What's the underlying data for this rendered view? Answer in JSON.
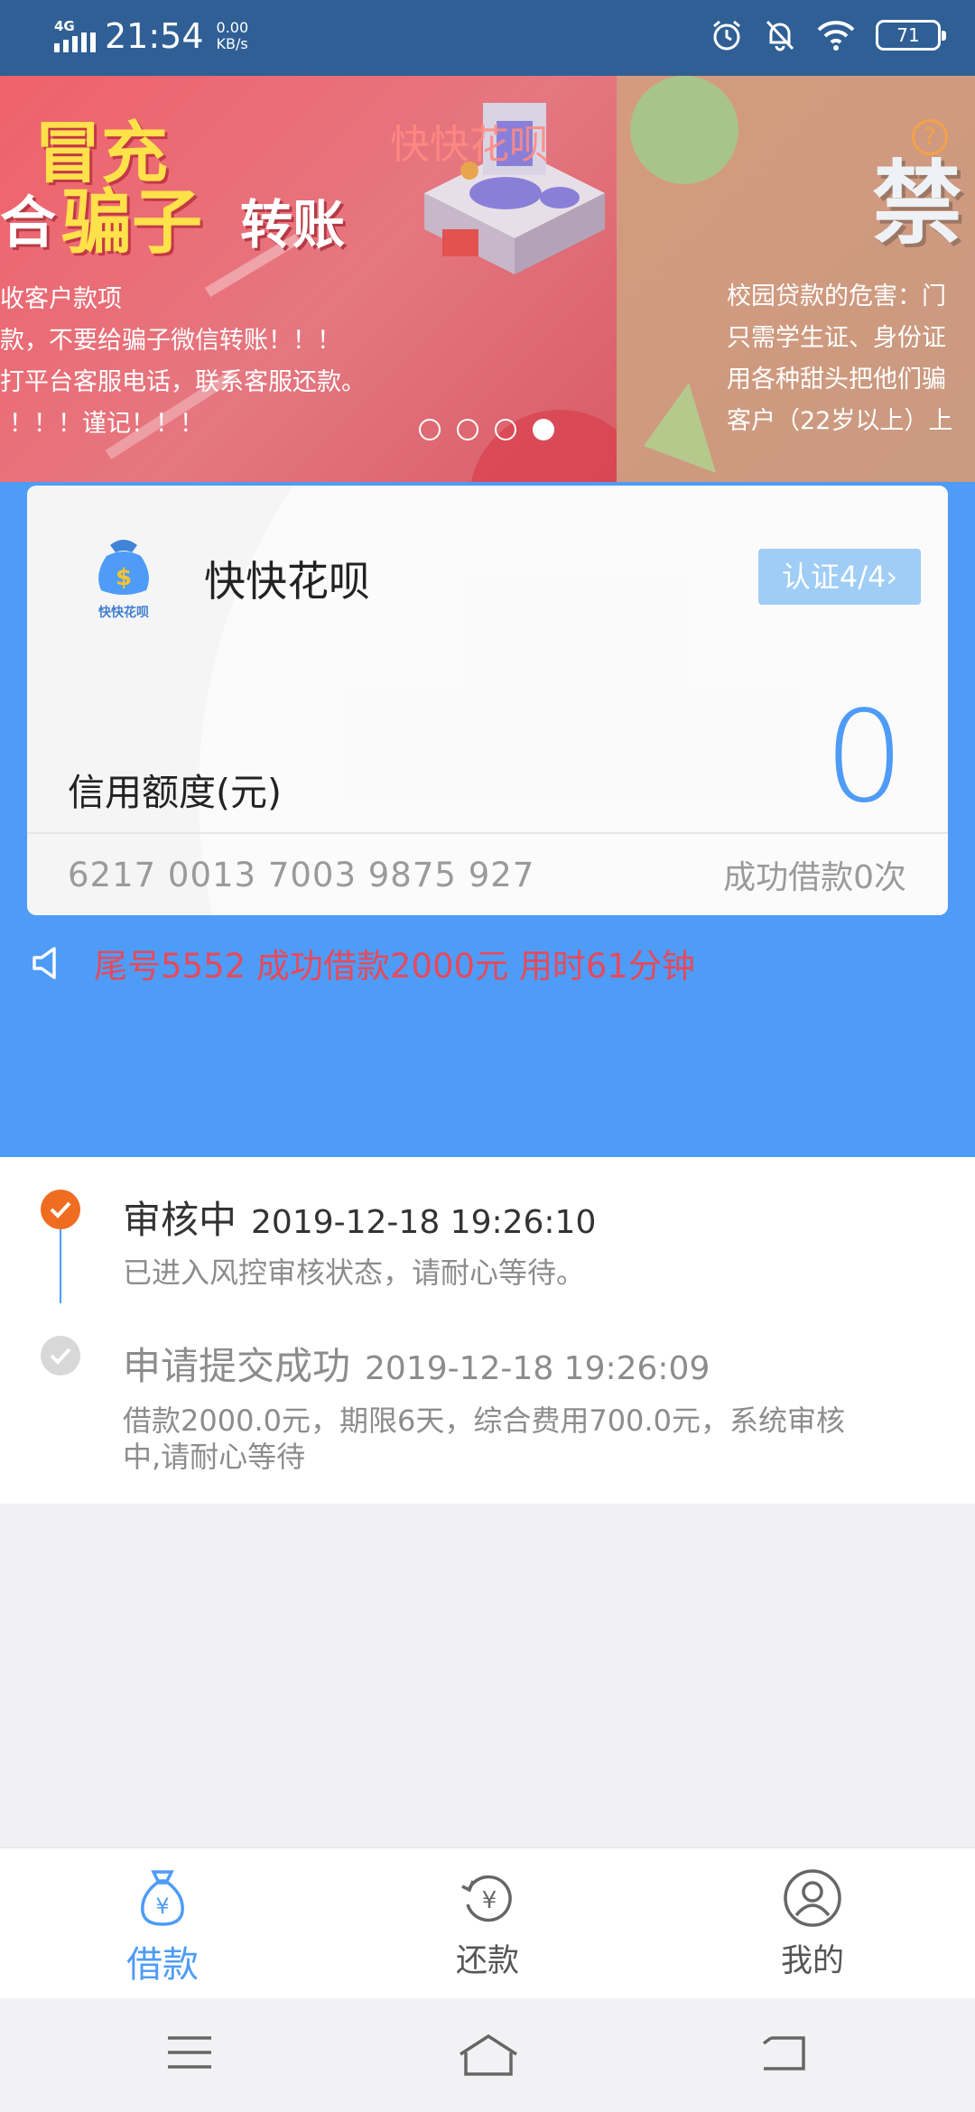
{
  "status_bar": {
    "network": "4G",
    "time": "21:54",
    "speed_value": "0.00",
    "speed_unit": "KB/s",
    "battery": "71",
    "icons": [
      "alarm-icon",
      "mute-bell-icon",
      "wifi-icon",
      "battery-icon"
    ]
  },
  "banner": {
    "slide1": {
      "headline_yellow_1": "冒充",
      "headline_yellow_2": "骗子",
      "headline_white_1": "合",
      "headline_white_2": "转账",
      "watermark": "快快花呗",
      "lines": [
        "收客户款项",
        "款，不要给骗子微信转账！！！",
        "打平台客服电话，联系客服还款。",
        "！！！谨记！！！"
      ]
    },
    "slide2": {
      "title": "禁",
      "lines": [
        "校园贷款的危害：门",
        "只需学生证、身份证",
        "用各种甜头把他们骗",
        "客户（22岁以上）上"
      ]
    },
    "dots": 4,
    "active_dot": 3
  },
  "card": {
    "app_name": "快快花呗",
    "logo_caption": "快快花呗",
    "cert_label": "认证4/4",
    "credit_label": "信用额度(元)",
    "credit_value": "0",
    "card_number": "6217 0013 7003 9875 927",
    "loan_count": "成功借款0次"
  },
  "notice": {
    "text": "尾号5552 成功借款2000元 用时61分钟"
  },
  "timeline": [
    {
      "title": "审核中",
      "time": "2019-12-18 19:26:10",
      "desc": "已进入风控审核状态，请耐心等待。",
      "status": "active"
    },
    {
      "title": "申请提交成功",
      "time": "2019-12-18 19:26:09",
      "desc_line1": "借款2000.0元，期限6天，综合费用700.0元，系统审核",
      "desc_line2": "中,请耐心等待",
      "status": "done"
    }
  ],
  "tabs": [
    {
      "label": "借款",
      "icon": "money-bag-icon",
      "active": true
    },
    {
      "label": "还款",
      "icon": "repay-icon",
      "active": false
    },
    {
      "label": "我的",
      "icon": "profile-icon",
      "active": false
    }
  ],
  "system_nav": [
    "menu-icon",
    "home-icon",
    "back-icon"
  ],
  "colors": {
    "status_bar": "#2f5f95",
    "primary": "#4e9cf7",
    "notice_red": "#e9485a",
    "timeline_active": "#ef6d20",
    "cert_button": "#9fcdf5"
  }
}
